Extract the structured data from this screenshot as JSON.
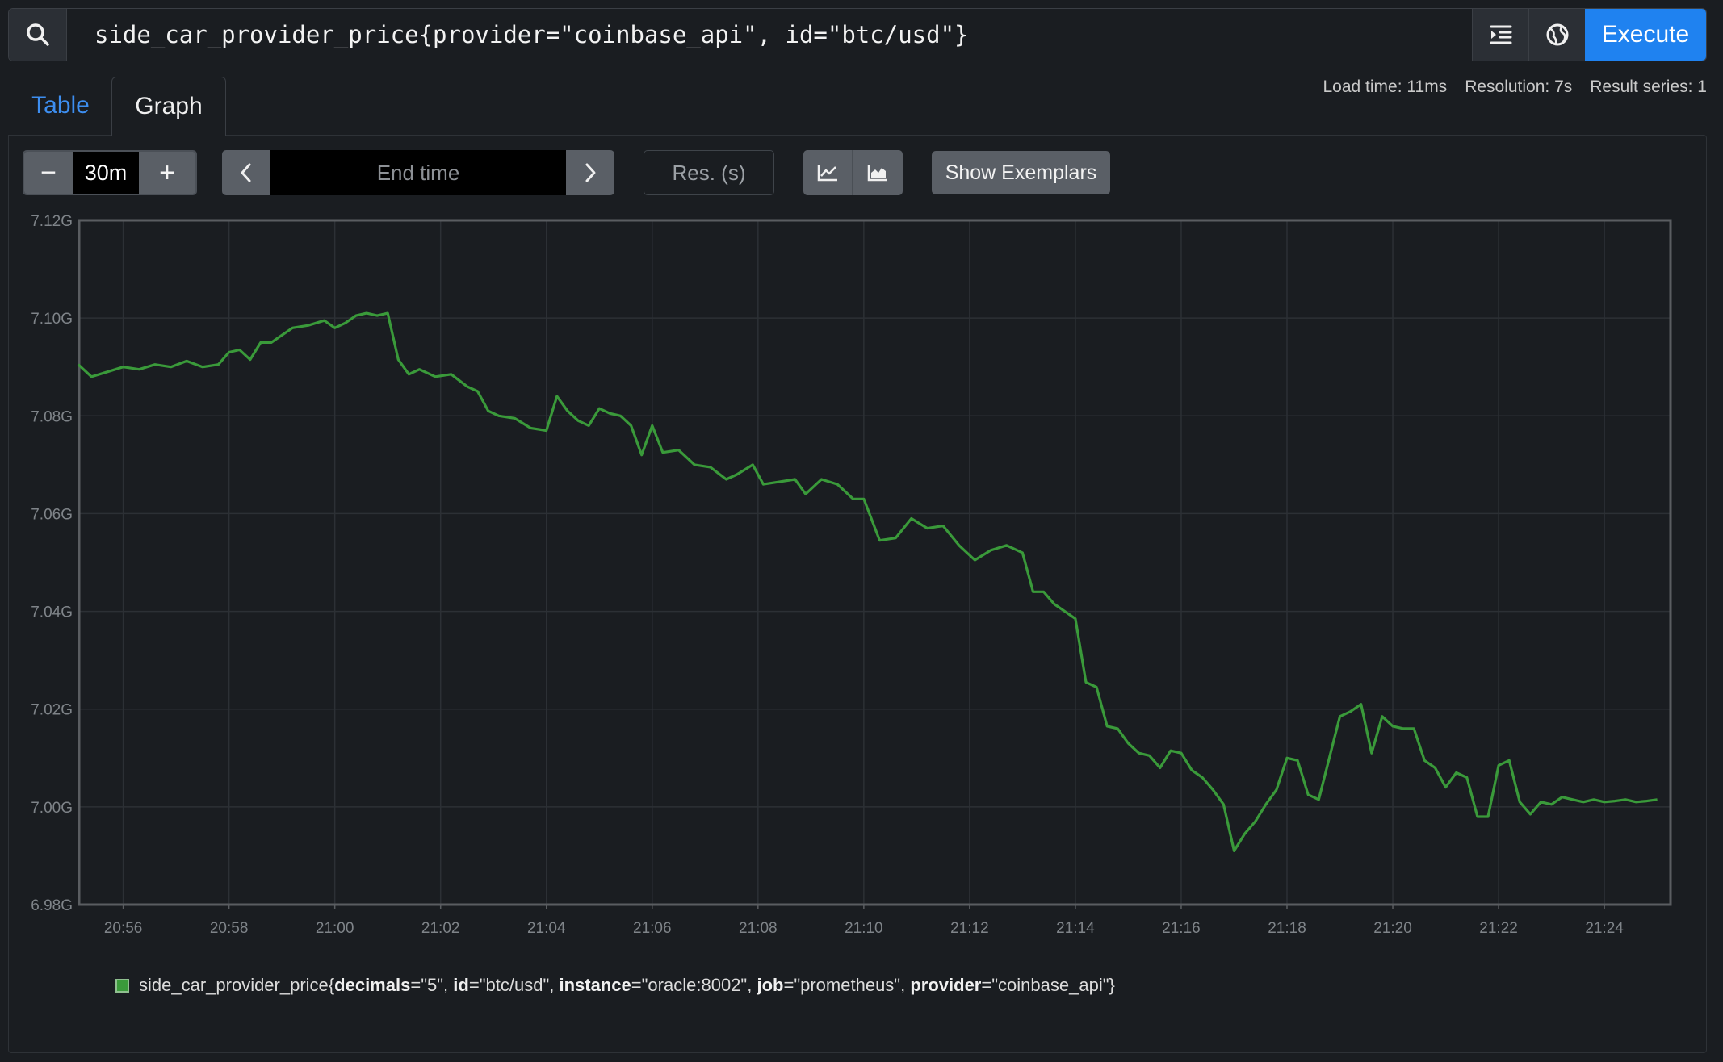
{
  "query": {
    "expression": "side_car_provider_price{provider=\"coinbase_api\", id=\"btc/usd\"}",
    "execute_label": "Execute",
    "icons": {
      "search": "search-icon",
      "format": "format-indent-icon",
      "metrics": "globe-icon"
    }
  },
  "tabs": {
    "table": "Table",
    "graph": "Graph"
  },
  "stats": {
    "load_time": "Load time: 11ms",
    "resolution": "Resolution: 7s",
    "result_series": "Result series: 1"
  },
  "controls": {
    "decrease": "−",
    "range": "30m",
    "increase": "+",
    "end_time_placeholder": "End time",
    "resolution_placeholder": "Res. (s)",
    "show_exemplars": "Show Exemplars",
    "icons": {
      "prev": "chevron-left-icon",
      "next": "chevron-right-icon",
      "line": "line-chart-icon",
      "stacked": "stacked-area-icon"
    }
  },
  "legend": {
    "metric": "side_car_provider_price",
    "labels": [
      {
        "key": "decimals",
        "value": "\"5\""
      },
      {
        "key": "id",
        "value": "\"btc/usd\""
      },
      {
        "key": "instance",
        "value": "\"oracle:8002\""
      },
      {
        "key": "job",
        "value": "\"prometheus\""
      },
      {
        "key": "provider",
        "value": "\"coinbase_api\""
      }
    ],
    "color": "#3a9a3a"
  },
  "chart_data": {
    "type": "line",
    "xlabel": "",
    "ylabel": "",
    "xlim": [
      "20:55:10",
      "21:25:15"
    ],
    "ylim": [
      6.98,
      7.12
    ],
    "y_unit": "G",
    "yticks": [
      "6.98G",
      "7.00G",
      "7.02G",
      "7.04G",
      "7.06G",
      "7.08G",
      "7.10G",
      "7.12G"
    ],
    "xticks": [
      "20:56",
      "20:58",
      "21:00",
      "21:02",
      "21:04",
      "21:06",
      "21:08",
      "21:10",
      "21:12",
      "21:14",
      "21:16",
      "21:18",
      "21:20",
      "21:22",
      "21:24"
    ],
    "grid": true,
    "series": [
      {
        "name": "side_car_provider_price{decimals=\"5\", id=\"btc/usd\", instance=\"oracle:8002\", job=\"prometheus\", provider=\"coinbase_api\"}",
        "color": "#3a9a3a",
        "x_minutes_from": "20:55",
        "x": [
          0.15,
          0.4,
          0.7,
          1.0,
          1.3,
          1.6,
          1.9,
          2.2,
          2.5,
          2.8,
          3.0,
          3.2,
          3.4,
          3.6,
          3.8,
          4.0,
          4.2,
          4.5,
          4.8,
          5.0,
          5.2,
          5.4,
          5.6,
          5.8,
          6.0,
          6.2,
          6.4,
          6.6,
          6.9,
          7.2,
          7.5,
          7.7,
          7.9,
          8.1,
          8.4,
          8.7,
          9.0,
          9.2,
          9.4,
          9.6,
          9.8,
          10.0,
          10.2,
          10.4,
          10.6,
          10.8,
          11.0,
          11.2,
          11.5,
          11.8,
          12.1,
          12.4,
          12.6,
          12.9,
          13.1,
          13.4,
          13.7,
          13.9,
          14.2,
          14.5,
          14.8,
          15.0,
          15.3,
          15.6,
          15.9,
          16.2,
          16.5,
          16.8,
          17.1,
          17.4,
          17.7,
          18.0,
          18.2,
          18.4,
          18.6,
          18.8,
          19.0,
          19.2,
          19.4,
          19.6,
          19.8,
          20.0,
          20.2,
          20.4,
          20.6,
          20.8,
          21.0,
          21.2,
          21.4,
          21.6,
          21.8,
          22.0,
          22.2,
          22.4,
          22.6,
          22.8,
          23.0,
          23.2,
          23.4,
          23.6,
          23.8,
          24.0,
          24.2,
          24.4,
          24.6,
          24.8,
          25.0,
          25.2,
          25.4,
          25.6,
          25.8,
          26.0,
          26.2,
          26.4,
          26.6,
          26.8,
          27.0,
          27.2,
          27.4,
          27.6,
          27.8,
          28.0,
          28.2,
          28.4,
          28.6,
          28.8,
          29.0,
          29.2,
          29.4,
          29.6,
          29.8,
          30.0
        ],
        "values": [
          7.0905,
          7.088,
          7.089,
          7.09,
          7.0895,
          7.0905,
          7.09,
          7.0912,
          7.09,
          7.0905,
          7.093,
          7.0935,
          7.0915,
          7.095,
          7.095,
          7.0965,
          7.098,
          7.0985,
          7.0995,
          7.098,
          7.099,
          7.1005,
          7.101,
          7.1005,
          7.101,
          7.0915,
          7.0885,
          7.0895,
          7.088,
          7.0885,
          7.086,
          7.085,
          7.081,
          7.08,
          7.0795,
          7.0775,
          7.077,
          7.084,
          7.081,
          7.079,
          7.078,
          7.0815,
          7.0805,
          7.08,
          7.078,
          7.072,
          7.078,
          7.0725,
          7.073,
          7.07,
          7.0695,
          7.067,
          7.068,
          7.07,
          7.066,
          7.0665,
          7.067,
          7.064,
          7.067,
          7.066,
          7.063,
          7.063,
          7.0545,
          7.055,
          7.059,
          7.057,
          7.0575,
          7.0535,
          7.0505,
          7.0525,
          7.0535,
          7.052,
          7.044,
          7.044,
          7.0415,
          7.04,
          7.0385,
          7.0255,
          7.0245,
          7.0165,
          7.016,
          7.013,
          7.011,
          7.0105,
          7.008,
          7.0115,
          7.011,
          7.0075,
          7.006,
          7.0035,
          7.0005,
          6.991,
          6.9945,
          6.997,
          7.0005,
          7.0035,
          7.01,
          7.0095,
          7.0025,
          7.0015,
          7.01,
          7.0185,
          7.0195,
          7.021,
          7.011,
          7.0185,
          7.0165,
          7.016,
          7.016,
          7.0095,
          7.008,
          7.004,
          7.007,
          7.006,
          6.998,
          6.998,
          7.0085,
          7.0095,
          7.001,
          6.9985,
          7.001,
          7.0005,
          7.002,
          7.0015,
          7.001,
          7.0015,
          7.001,
          7.0012,
          7.0015,
          7.001,
          7.0012,
          7.0015
        ]
      }
    ]
  }
}
